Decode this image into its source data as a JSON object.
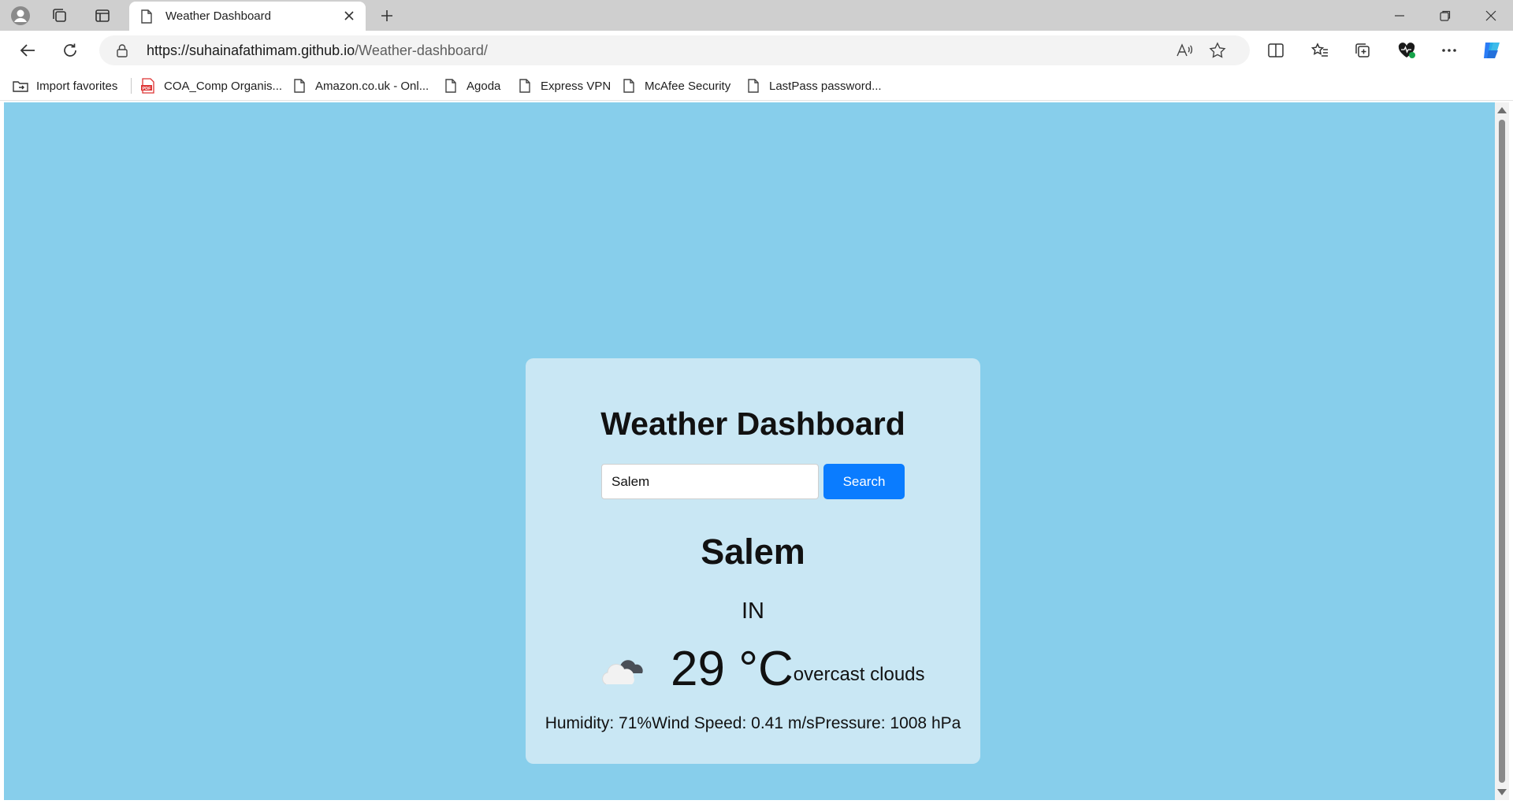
{
  "browser": {
    "tab_title": "Weather Dashboard",
    "url_domain": "https://suhainafathimam.github.io",
    "url_path": "/Weather-dashboard/"
  },
  "bookmarks": [
    {
      "label": "Import favorites",
      "icon": "import-favorites-icon"
    },
    {
      "label": "COA_Comp Organis...",
      "icon": "pdf-icon"
    },
    {
      "label": "Amazon.co.uk - Onl...",
      "icon": "page-icon"
    },
    {
      "label": "Agoda",
      "icon": "page-icon"
    },
    {
      "label": "Express VPN",
      "icon": "page-icon"
    },
    {
      "label": "McAfee Security",
      "icon": "page-icon"
    },
    {
      "label": "LastPass password...",
      "icon": "page-icon"
    }
  ],
  "page": {
    "heading": "Weather Dashboard",
    "search": {
      "value": "Salem",
      "button_label": "Search"
    },
    "city": "Salem",
    "country": "IN",
    "temperature": "29 °C",
    "description": "overcast clouds",
    "weather_icon": "overcast-clouds-icon",
    "humidity": "Humidity: 71%",
    "wind": "Wind Speed: 0.41 m/s",
    "pressure": "Pressure: 1008 hPa"
  },
  "colors": {
    "page_bg": "#87ceeb",
    "card_bg": "#c9e7f4",
    "button": "#0a7cff"
  }
}
